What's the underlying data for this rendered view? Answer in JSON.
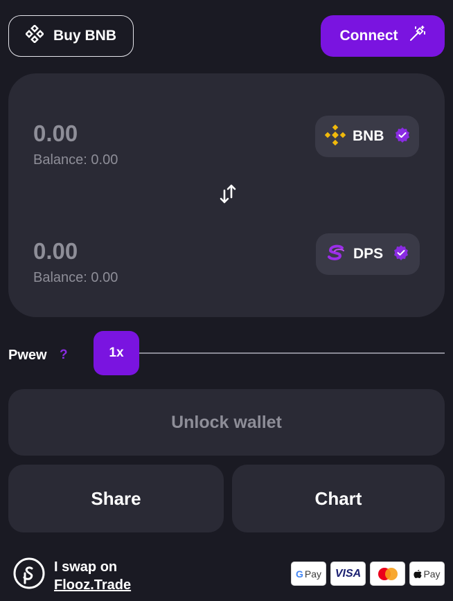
{
  "header": {
    "buy_label": "Buy BNB",
    "connect_label": "Connect"
  },
  "swap": {
    "from": {
      "amount": "0.00",
      "balance": "Balance: 0.00",
      "token": "BNB"
    },
    "to": {
      "amount": "0.00",
      "balance": "Balance: 0.00",
      "token": "DPS"
    }
  },
  "slippage": {
    "label": "Pwew",
    "help": "?",
    "value": "1x"
  },
  "actions": {
    "unlock_label": "Unlock wallet",
    "share_label": "Share",
    "chart_label": "Chart"
  },
  "footer": {
    "line1": "I swap on",
    "line2": "Flooz.Trade",
    "payments": {
      "gpay": "Pay",
      "visa": "VISA",
      "applepay": "Pay"
    }
  },
  "colors": {
    "background": "#1a1a23",
    "card": "#2a2a35",
    "pill": "#3a3a47",
    "accent": "#7a14e0",
    "muted_text": "#8e8e98",
    "bnb_yellow": "#f0b90b"
  },
  "icons": [
    "bnb-icon",
    "magic-wand-icon",
    "verified-check-icon",
    "swap-arrows-icon",
    "dps-icon",
    "help-icon",
    "flooz-logo-icon",
    "gpay-icon",
    "visa-icon",
    "mastercard-icon",
    "applepay-icon"
  ]
}
